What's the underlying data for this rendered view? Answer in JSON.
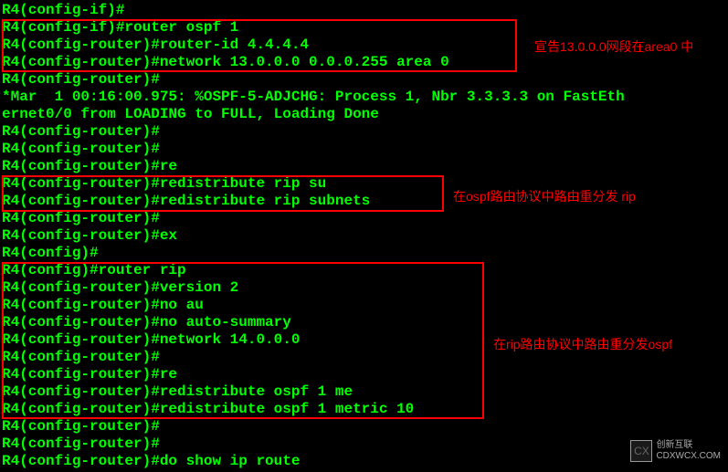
{
  "lines": [
    "R4(config-if)#",
    "R4(config-if)#router ospf 1",
    "R4(config-router)#router-id 4.4.4.4",
    "R4(config-router)#network 13.0.0.0 0.0.0.255 area 0",
    "R4(config-router)#",
    "*Mar  1 00:16:00.975: %OSPF-5-ADJCHG: Process 1, Nbr 3.3.3.3 on FastEth",
    "ernet0/0 from LOADING to FULL, Loading Done",
    "R4(config-router)#",
    "R4(config-router)#",
    "R4(config-router)#re",
    "R4(config-router)#redistribute rip su",
    "R4(config-router)#redistribute rip subnets",
    "R4(config-router)#",
    "R4(config-router)#ex",
    "R4(config)#",
    "R4(config)#router rip",
    "R4(config-router)#version 2",
    "R4(config-router)#no au",
    "R4(config-router)#no auto-summary",
    "R4(config-router)#network 14.0.0.0",
    "R4(config-router)#",
    "R4(config-router)#re",
    "R4(config-router)#redistribute ospf 1 me",
    "R4(config-router)#redistribute ospf 1 metric 10",
    "R4(config-router)#",
    "R4(config-router)#",
    "R4(config-router)#do show ip route"
  ],
  "annotations": {
    "ann1": "宣告13.0.0.0网段在area0 中",
    "ann2": "在ospf路由协议中路由重分发 rip",
    "ann3": "在rip路由协议中路由重分发ospf"
  },
  "watermark": {
    "logo": "CX",
    "text1": "创新互联",
    "text2": "CDXWCX.COM"
  }
}
